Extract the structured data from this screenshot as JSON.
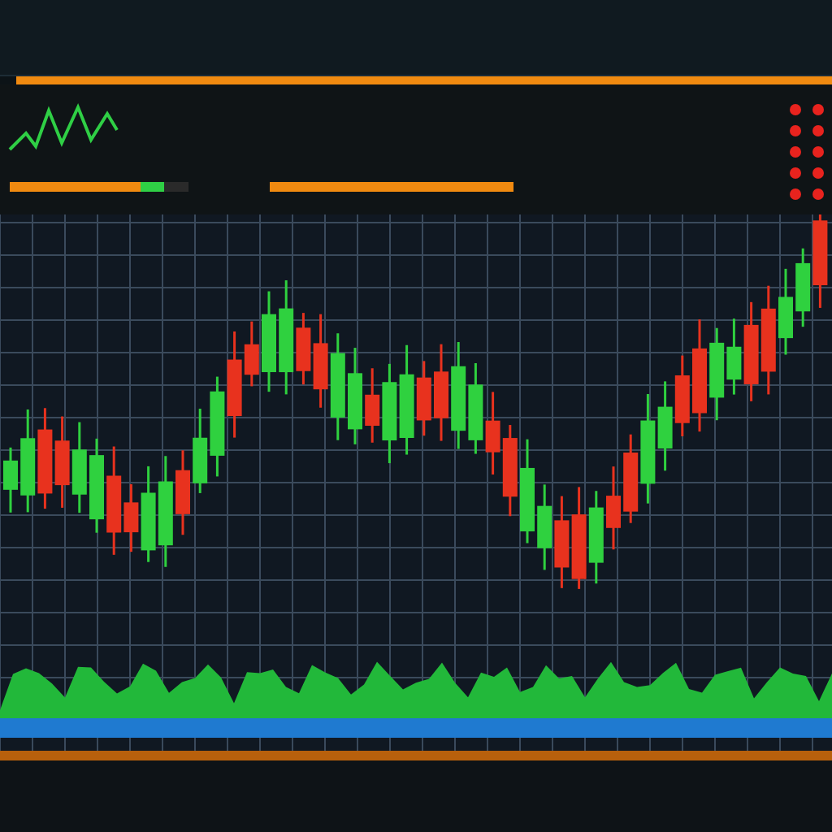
{
  "header": {
    "progress_bars": [
      {
        "level": 0.86
      },
      {
        "level": 1.0
      }
    ]
  },
  "status_dots": [
    {
      "color": "#e8231e"
    },
    {
      "color": "#e8231e"
    },
    {
      "color": "#e8231e"
    },
    {
      "color": "#e8231e"
    },
    {
      "color": "#e8231e"
    },
    {
      "color": "#e8231e"
    },
    {
      "color": "#e8231e"
    },
    {
      "color": "#e8231e"
    },
    {
      "color": "#e8231e"
    },
    {
      "color": "#e8231e"
    }
  ]
}
